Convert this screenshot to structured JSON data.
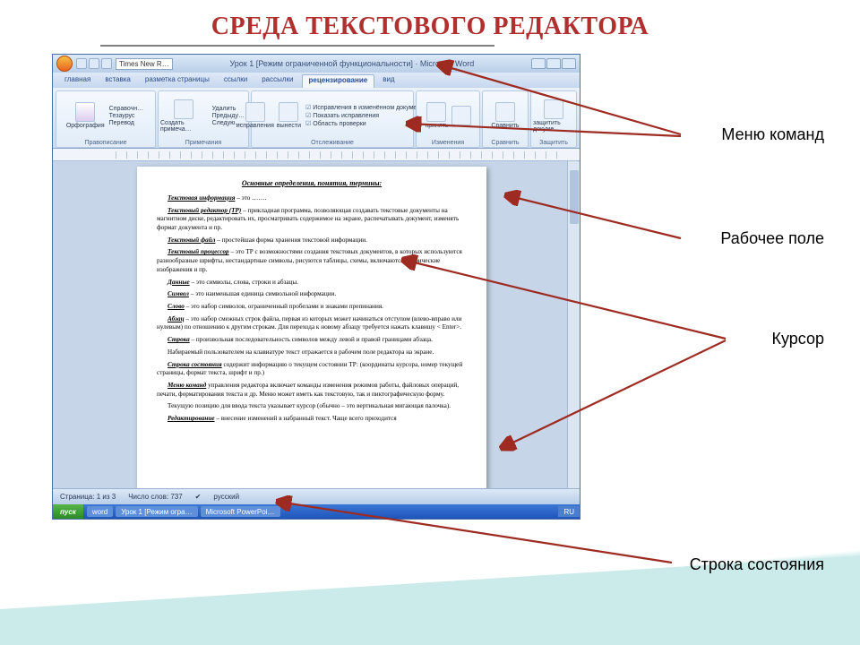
{
  "slide": {
    "title": "СРЕДА ТЕКСТОВОГО РЕДАКТОРА"
  },
  "callouts": {
    "menu": "Меню команд",
    "work_area": "Рабочее поле",
    "cursor": "Курсор",
    "status_bar": "Строка состояния"
  },
  "window": {
    "font_box": "Times New R…",
    "title": "Урок 1 [Режим ограниченной функциональности] · Microsoft Word"
  },
  "tabs": {
    "home": "главная",
    "insert": "вставка",
    "layout": "разметка страницы",
    "refs": "ссылки",
    "mail": "рассылки",
    "review": "рецензирование",
    "view": "вид"
  },
  "ribbon": {
    "g1": {
      "btn": "Орфография",
      "lines": [
        "Справочн…",
        "Тезаурус",
        "Перевод"
      ],
      "label": "Правописание"
    },
    "g2": {
      "btn": "Создать примеча…",
      "lines": [
        "Удалить",
        "Предыду…",
        "Следую…"
      ],
      "label": "Примечания"
    },
    "g3": {
      "left_lines": [
        "Исправления в изменённом докумен…",
        "Показать исправления",
        "Область проверки"
      ],
      "btn1": "исправления",
      "btn2": "вынести",
      "label": "Отслеживание"
    },
    "g4": {
      "btn1": "принять",
      "btn2": "",
      "label": "Изменения"
    },
    "g5": {
      "btn": "Сравнить",
      "label": "Сравнить"
    },
    "g6": {
      "btn": "защитить докуме…",
      "label": "Защитить"
    }
  },
  "page": {
    "heading": "Основные определения, понятия, термины:",
    "p1a": "Текстовая информация",
    "p1b": " – это …….",
    "p2a": "Текстовый редактор (ТР)",
    "p2b": " – прикладная программа, позволяющая создавать текстовые документы на магнитном диске, редактировать их, просматривать содержимое на экране, распечатывать документ, изменять формат документа и пр.",
    "p3a": "Текстовый файл",
    "p3b": " – простейшая форма хранения текстовой информации.",
    "p4a": "Текстовый процессор",
    "p4b": " – это ТР с возможностями создания текстовых документов, в которых используются разнообразные шрифты, нестандартные символы, рисуются таблицы, схемы, включаются графические изображения и пр.",
    "p5a": "Данные",
    "p5b": " – это символы, слова, строки и абзацы.",
    "p6a": "Символ",
    "p6b": " – это наименьшая единица символьной информации.",
    "p7a": "Слово",
    "p7b": " – это набор символов, ограниченный пробелами и знаками препинания.",
    "p8a": "Абзац",
    "p8b": " – это набор смежных строк файла, первая из которых может начинаться отступом (влево-вправо или нулевым) по отношению к другим строкам. Для перехода к новому абзацу требуется нажать клавишу < Enter>.",
    "p9a": "Строка",
    "p9b": " – произвольная последовательность символов между левой и правой границами абзаца.",
    "p10": "Набираемый пользователем на клавиатуре текст отражается в рабочем поле редактора на экране.",
    "p11a": "Строка состояния",
    "p11b": " содержит информацию о текущем состоянии ТР: (координаты курсора, номер текущей страницы, формат текста, шрифт и пр.)",
    "p12a": "Меню команд",
    "p12b": " управления редактора включает команды изменения режимов работы, файловых операций, печати, форматирования текста и др. Меню может иметь как текстовую, так и пиктографическую форму.",
    "p13": "Текущую позицию для ввода текста указывает курсор (обычно – это вертикальная мигающая палочка).",
    "p14a": "Редактирование",
    "p14b": " – внесение изменений в набранный текст. Чаще всего приходится"
  },
  "status": {
    "pages": "Страница: 1 из 3",
    "words": "Число слов: 737",
    "lang": "русский"
  },
  "taskbar": {
    "start": "пуск",
    "task_word": "word",
    "task_doc": "Урок 1 [Режим огра…",
    "task_ppt": "Microsoft PowerPoi…",
    "tray": "RU"
  }
}
